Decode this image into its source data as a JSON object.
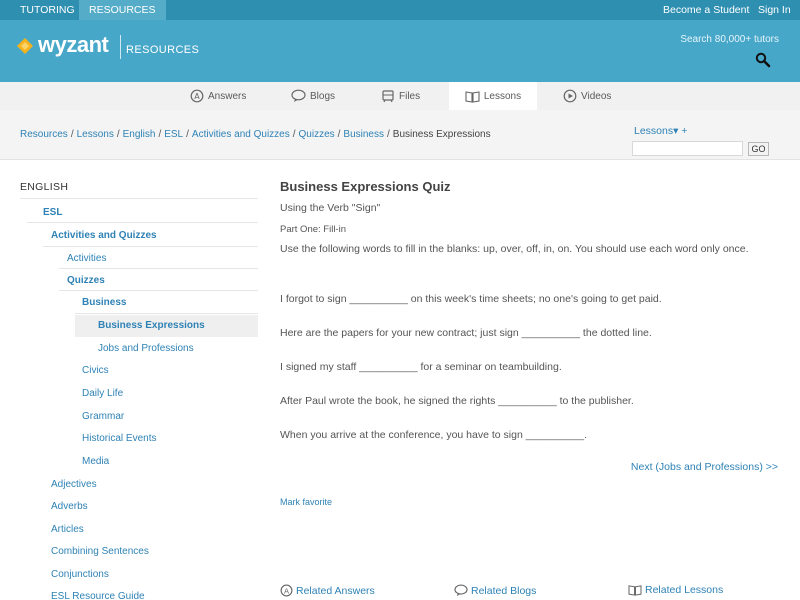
{
  "topbar": {
    "left_tabs": [
      "TUTORING",
      "RESOURCES"
    ],
    "become_student": "Become a Student",
    "sign_in": "Sign In"
  },
  "header": {
    "logo": "wyzant",
    "section": "RESOURCES",
    "search_label": "Search 80,000+ tutors",
    "search_icon": "magnifier-icon"
  },
  "nav": {
    "items": [
      {
        "label": "Answers",
        "icon": "answers-icon"
      },
      {
        "label": "Blogs",
        "icon": "blogs-icon"
      },
      {
        "label": "Files",
        "icon": "files-icon"
      },
      {
        "label": "Lessons",
        "icon": "lessons-icon"
      },
      {
        "label": "Videos",
        "icon": "videos-icon"
      }
    ]
  },
  "breadcrumb": {
    "links": [
      "Resources",
      "Lessons",
      "English",
      "ESL",
      "Activities and Quizzes",
      "Quizzes",
      "Business"
    ],
    "current": "Business Expressions",
    "separator": "/"
  },
  "lessons_search": {
    "dropdown_label": "Lessons▾ +",
    "go_label": "GO",
    "value": ""
  },
  "sidebar": {
    "title": "ENGLISH",
    "items": [
      {
        "label": "ESL"
      },
      {
        "label": "Activities and Quizzes"
      },
      {
        "label": "Activities"
      },
      {
        "label": "Quizzes"
      },
      {
        "label": "Business"
      },
      {
        "label": "Business Expressions"
      },
      {
        "label": "Jobs and Professions"
      },
      {
        "label": "Civics"
      },
      {
        "label": "Daily Life"
      },
      {
        "label": "Grammar"
      },
      {
        "label": "Historical Events"
      },
      {
        "label": "Media"
      },
      {
        "label": "Adjectives"
      },
      {
        "label": "Adverbs"
      },
      {
        "label": "Articles"
      },
      {
        "label": "Combining Sentences"
      },
      {
        "label": "Conjunctions"
      },
      {
        "label": "ESL Resource Guide"
      }
    ]
  },
  "main": {
    "title": "Business Expressions Quiz",
    "subtitle": "Using the Verb \"Sign\"",
    "part": "Part One: Fill-in",
    "instructions": "Use the following words to fill in the blanks: up, over, off, in, on. You should use each word only once.",
    "sentences": [
      "I forgot to sign __________ on this week's time sheets; no one's going to get paid.",
      "Here are the papers for your new contract; just sign __________ the dotted line.",
      "I signed my staff __________ for a seminar on teambuilding.",
      "After Paul wrote the book, he signed the rights __________ to the publisher.",
      "When you arrive at the conference, you have to sign __________."
    ],
    "next_link": "Next (Jobs and Professions) >>",
    "mark_favorite": "Mark favorite"
  },
  "related": {
    "answers": "Related Answers",
    "blogs": "Related Blogs",
    "lessons": "Related Lessons"
  },
  "colors": {
    "topbar": "#2e8fb1",
    "header": "#47a7c9",
    "link": "#2e82b5",
    "logo_mark": "#f5b21b"
  }
}
